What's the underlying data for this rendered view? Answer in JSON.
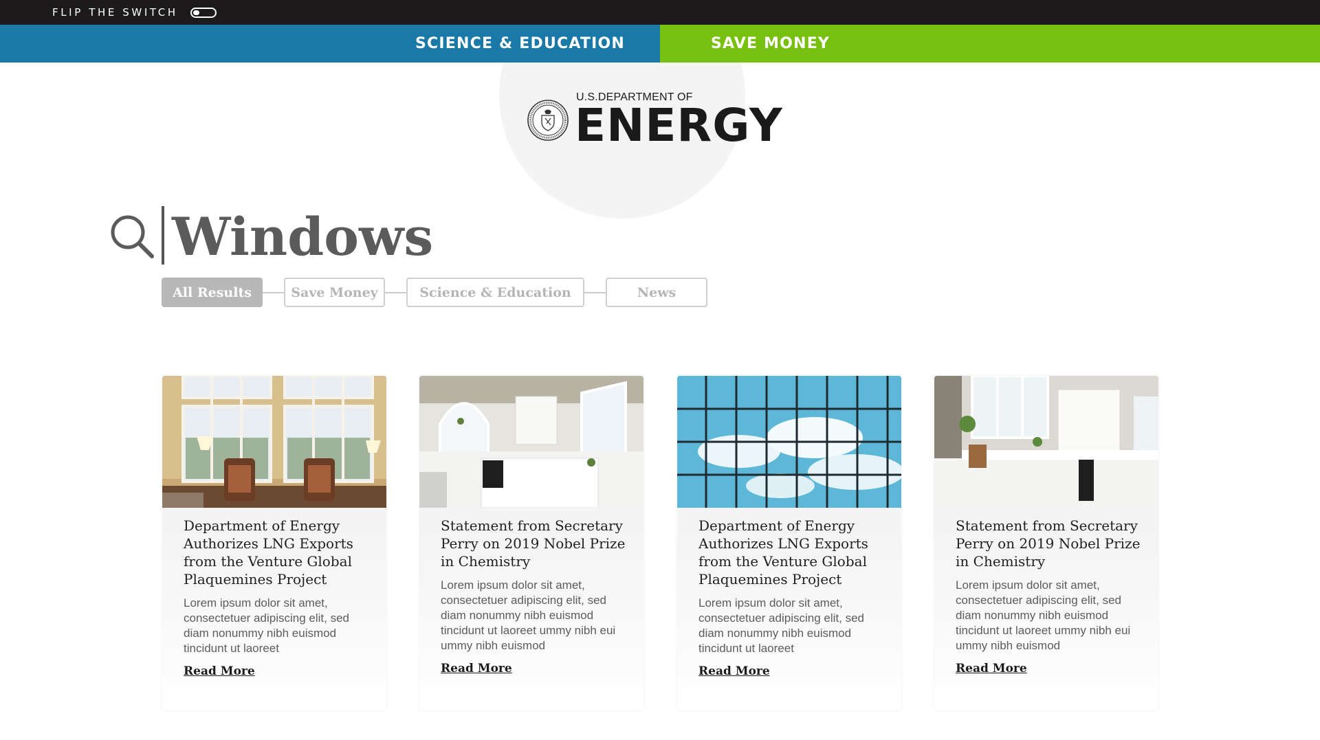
{
  "topbar": {
    "flip_label": "FLIP THE SWITCH"
  },
  "nav": {
    "science_label": "SCIENCE & EDUCATION",
    "save_label": "SAVE MONEY"
  },
  "logo": {
    "top_text": "U.S.DEPARTMENT OF",
    "main_text": "ENERGY"
  },
  "search": {
    "term": "Windows"
  },
  "filters": [
    "All Results",
    "Save Money",
    "Science & Education",
    "News"
  ],
  "cards": [
    {
      "image": "living-room-windows",
      "title": "Department of Energy Authorizes LNG  Exports from the  Venture Global Plaquemines Project",
      "text": "Lorem ipsum dolor sit amet, consectetuer adipiscing elit, sed diam nonummy nibh euismod tincidunt ut laoreet",
      "link": "Read More"
    },
    {
      "image": "white-kitchen",
      "title": "Statement from Secretary Perry on 2019 Nobel Prize in Chemistry",
      "text": "Lorem ipsum dolor sit amet, consectetuer adipiscing elit, sed diam nonummy nibh euismod tincidunt ut laoreet ummy nibh eui ummy nibh euismod",
      "link": "Read More"
    },
    {
      "image": "glass-facade-sky",
      "title": "Department of Energy Authorizes LNG  Exports from the  Venture Global Plaquemines Project",
      "text": "Lorem ipsum dolor sit amet, consectetuer adipiscing elit, sed diam nonummy nibh euismod tincidunt ut laoreet",
      "link": "Read More"
    },
    {
      "image": "kitchen-counter",
      "title": "Statement from Secretary Perry on 2019 Nobel Prize in Chemistry",
      "text": "Lorem ipsum dolor sit amet, consectetuer adipiscing elit, sed diam nonummy nibh euismod tincidunt ut laoreet ummy nibh eui ummy nibh euismod",
      "link": "Read More"
    }
  ],
  "colors": {
    "nav_science": "#1b79a8",
    "nav_save": "#78c010",
    "topbar": "#1c1a1b"
  }
}
